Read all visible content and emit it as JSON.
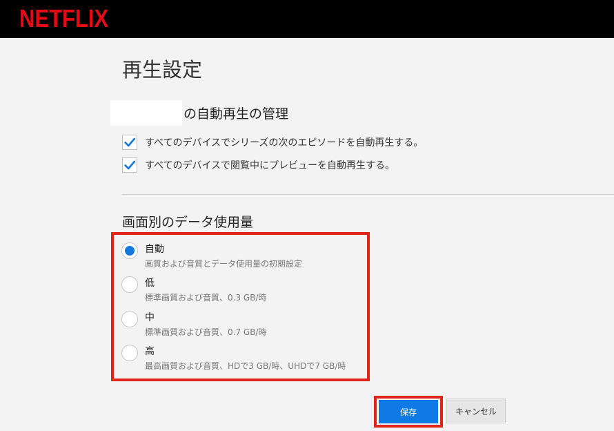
{
  "header": {
    "logo_text": "NETFLIX",
    "brand_color": "#e50914"
  },
  "page": {
    "title": "再生設定"
  },
  "autoplay": {
    "section_title": "の自動再生の管理",
    "options": [
      {
        "label": "すべてのデバイスでシリーズの次のエピソードを自動再生する。",
        "checked": true
      },
      {
        "label": "すべてのデバイスで閲覧中にプレビューを自動再生する。",
        "checked": true
      }
    ]
  },
  "data_usage": {
    "section_title": "画面別のデータ使用量",
    "selected": "自動",
    "options": [
      {
        "label": "自動",
        "description": "画質および音質とデータ使用量の初期設定"
      },
      {
        "label": "低",
        "description": "標準画質および音質、0.3 GB/時"
      },
      {
        "label": "中",
        "description": "標準画質および音質、0.7 GB/時"
      },
      {
        "label": "高",
        "description": "最高画質および音質、HDで3 GB/時、UHDで7 GB/時"
      }
    ]
  },
  "actions": {
    "save_label": "保存",
    "cancel_label": "キャンセル",
    "save_color": "#0f7ae5",
    "highlight_color": "#e0241a"
  }
}
